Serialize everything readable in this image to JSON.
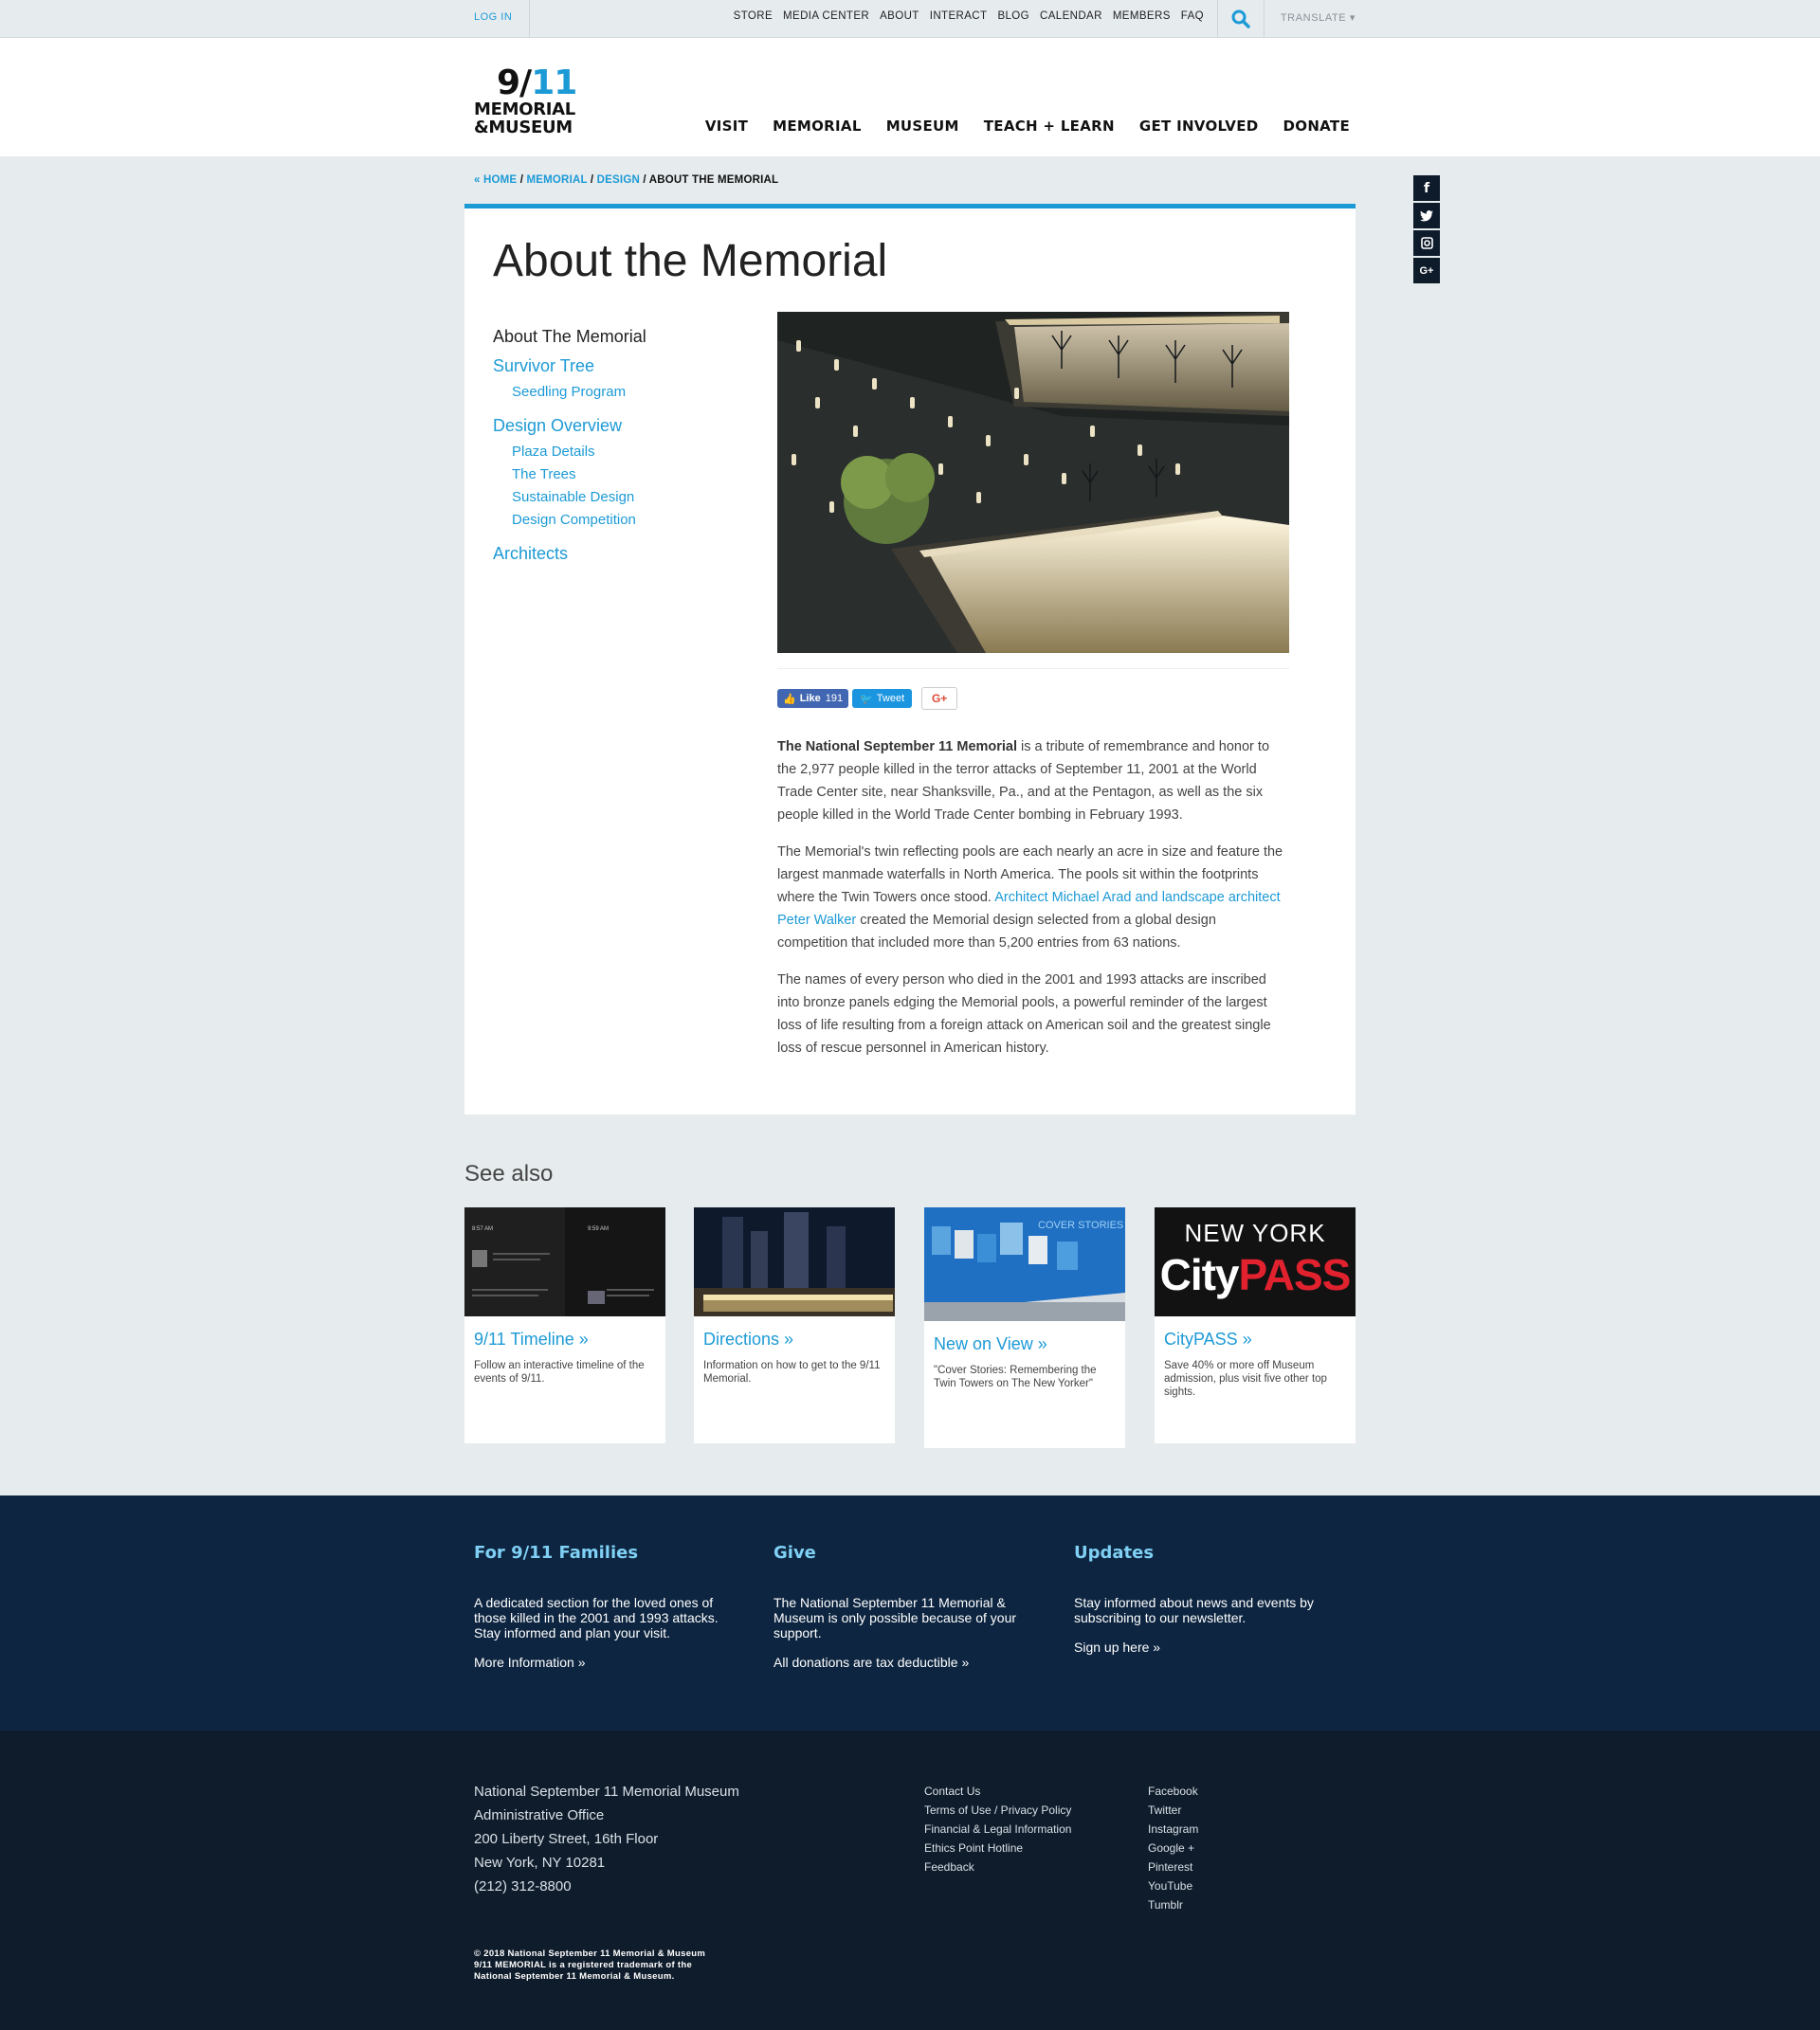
{
  "topbar": {
    "login": "LOG IN",
    "utility": [
      "STORE",
      "MEDIA CENTER",
      "ABOUT",
      "INTERACT",
      "BLOG",
      "CALENDAR",
      "MEMBERS",
      "FAQ"
    ],
    "translate": "TRANSLATE ▾",
    "accent": "#1c9ad6"
  },
  "logo": {
    "number_prefix": "9/",
    "number_suffix": "11",
    "line1": "MEMORIAL",
    "line2": "&MUSEUM"
  },
  "nav": [
    "VISIT",
    "MEMORIAL",
    "MUSEUM",
    "TEACH + LEARN",
    "GET INVOLVED",
    "DONATE"
  ],
  "breadcrumb": {
    "home": "« HOME",
    "memorial": "MEMORIAL",
    "design": "DESIGN",
    "current": "ABOUT THE MEMORIAL"
  },
  "social_rail": [
    "f",
    "t",
    "ig",
    "G+"
  ],
  "page": {
    "title": "About the Memorial",
    "sidenav": {
      "current": "About The Memorial",
      "survivor": "Survivor Tree",
      "seedling": "Seedling Program",
      "design_overview": "Design Overview",
      "plaza": "Plaza Details",
      "trees": "The Trees",
      "sustainable": "Sustainable Design",
      "competition": "Design Competition",
      "architects": "Architects"
    },
    "share": {
      "like": "Like",
      "like_count": "191",
      "tweet": "Tweet",
      "gplus": "G+"
    },
    "p1_bold": "The National September 11 Memorial",
    "p1_rest": " is a tribute of remembrance and honor to the 2,977 people killed in the terror attacks of September 11, 2001 at the World Trade Center site, near Shanksville, Pa., and at the Pentagon, as well as the six people killed in the World Trade Center bombing in February 1993.",
    "p2_a": "The Memorial's twin reflecting pools are each nearly an acre in size and feature the largest manmade waterfalls in North America. The pools sit within the footprints where the Twin Towers once stood. ",
    "p2_link": "Architect Michael Arad and landscape architect Peter Walker",
    "p2_b": " created the Memorial design selected from a global design competition that included more than 5,200 entries from 63 nations.",
    "p3": "The names of every person who died in the 2001 and 1993 attacks are inscribed into bronze panels edging the Memorial pools, a powerful reminder of the largest loss of life resulting from a foreign attack on American soil and the greatest single loss of rescue personnel in American history."
  },
  "see_also": {
    "heading": "See also",
    "tiles": [
      {
        "title": "9/11 Timeline »",
        "desc": "Follow an interactive timeline of the events of 9/11.",
        "img_text_1": "8:57 AM",
        "img_text_2": "9:59 AM"
      },
      {
        "title": "Directions »",
        "desc": "Information on how to get to the 9/11 Memorial."
      },
      {
        "title": "New on View »",
        "desc": "\"Cover Stories: Remembering the Twin Towers on The New Yorker\"",
        "img_text": "COVER STORIES"
      },
      {
        "title": "CityPASS »",
        "desc": "Save 40% or more off Museum admission, plus visit five other top sights.",
        "img_line1": "NEW YORK",
        "img_city": "City",
        "img_pass": "PASS"
      }
    ]
  },
  "band": {
    "families": {
      "title": "For 9/11 Families",
      "text": "A dedicated section for the loved ones of those killed in the 2001 and 1993 attacks. Stay informed and plan your visit.",
      "link": "More Information »"
    },
    "give": {
      "title": "Give",
      "text": "The National September 11 Memorial & Museum is only possible because of your support.",
      "link": "All donations are tax deductible »"
    },
    "updates": {
      "title": "Updates",
      "text": "Stay informed about news and events by subscribing to our newsletter.",
      "link": "Sign up here »"
    }
  },
  "footer": {
    "address": [
      "National September 11 Memorial Museum",
      "Administrative Office",
      "200 Liberty Street, 16th Floor",
      "New York, NY 10281",
      "(212) 312-8800"
    ],
    "links": [
      "Contact Us",
      "Terms of Use / Privacy Policy",
      "Financial & Legal Information",
      "Ethics Point Hotline",
      "Feedback"
    ],
    "social": [
      "Facebook",
      "Twitter",
      "Instagram",
      "Google +",
      "Pinterest",
      "YouTube",
      "Tumblr"
    ],
    "copyright": [
      "© 2018 National September 11 Memorial & Museum",
      "9/11 MEMORIAL is a registered trademark of the",
      "National September 11 Memorial & Museum."
    ]
  }
}
